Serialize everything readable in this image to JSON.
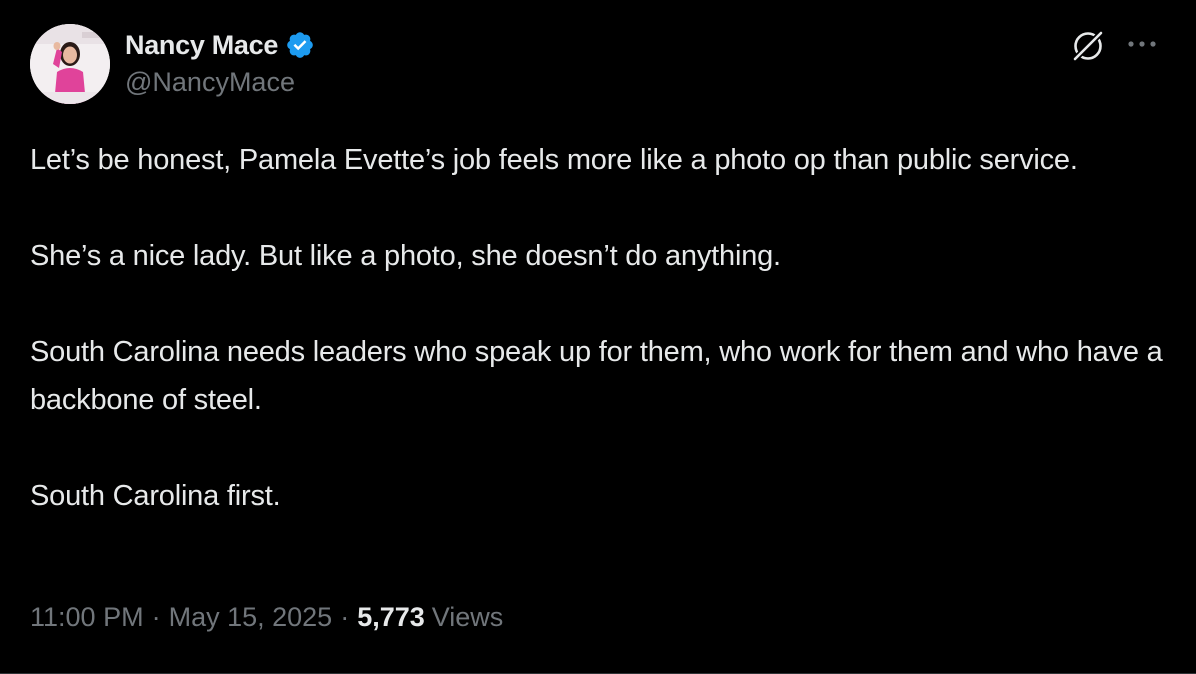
{
  "author": {
    "display_name": "Nancy Mace",
    "handle": "@NancyMace",
    "verified": true,
    "avatar_icon": "avatar-photo"
  },
  "icons": {
    "verified": "verified-badge-icon",
    "grok": "grok-icon",
    "more": "more-options-icon"
  },
  "tweet": {
    "paragraphs": [
      "Let’s be honest, Pamela Evette’s job feels more like a photo op than public service.",
      "She’s a nice lady. But like a photo, she doesn’t do anything.",
      "South Carolina needs leaders who speak up for them, who work for them and who have a backbone of steel.",
      "South Carolina first."
    ]
  },
  "meta": {
    "time": "11:00 PM",
    "separator": "·",
    "date": "May 15, 2025",
    "views_count": "5,773",
    "views_label": "Views"
  },
  "colors": {
    "background": "#000000",
    "text_primary": "#e7e9ea",
    "text_secondary": "#71767b",
    "verified_blue": "#1d9bf0"
  }
}
